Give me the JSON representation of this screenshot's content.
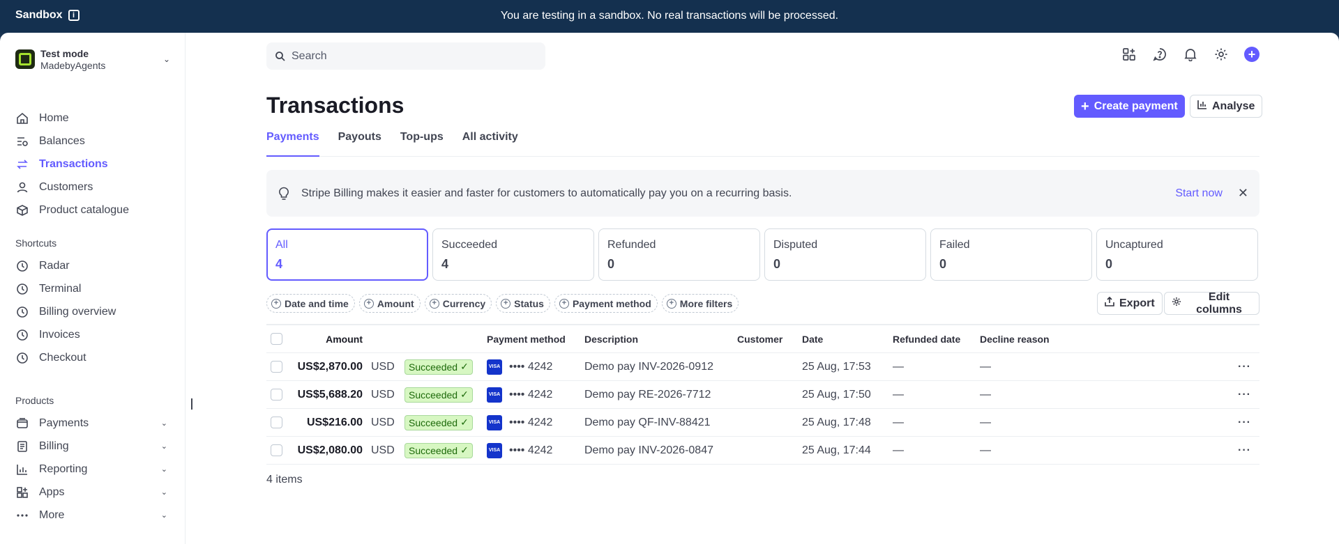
{
  "banner": {
    "label": "Sandbox",
    "message": "You are testing in a sandbox. No real transactions will be processed."
  },
  "account": {
    "mode": "Test mode",
    "name": "MadebyAgents"
  },
  "nav": {
    "main": [
      {
        "label": "Home",
        "icon": "home-icon"
      },
      {
        "label": "Balances",
        "icon": "balances-icon"
      },
      {
        "label": "Transactions",
        "icon": "transactions-icon",
        "active": true
      },
      {
        "label": "Customers",
        "icon": "customers-icon"
      },
      {
        "label": "Product catalogue",
        "icon": "product-icon"
      }
    ],
    "shortcuts_title": "Shortcuts",
    "shortcuts": [
      "Radar",
      "Terminal",
      "Billing overview",
      "Invoices",
      "Checkout"
    ],
    "products_title": "Products",
    "products": [
      "Payments",
      "Billing",
      "Reporting",
      "Apps",
      "More"
    ]
  },
  "search": {
    "placeholder": "Search"
  },
  "page": {
    "title": "Transactions",
    "create_label": "Create payment",
    "analyse_label": "Analyse"
  },
  "tabs": [
    "Payments",
    "Payouts",
    "Top-ups",
    "All activity"
  ],
  "notice": {
    "text": "Stripe Billing makes it easier and faster for customers to automatically pay you on a recurring basis.",
    "link": "Start now"
  },
  "cards": [
    {
      "label": "All",
      "count": "4"
    },
    {
      "label": "Succeeded",
      "count": "4"
    },
    {
      "label": "Refunded",
      "count": "0"
    },
    {
      "label": "Disputed",
      "count": "0"
    },
    {
      "label": "Failed",
      "count": "0"
    },
    {
      "label": "Uncaptured",
      "count": "0"
    }
  ],
  "filters": [
    "Date and time",
    "Amount",
    "Currency",
    "Status",
    "Payment method",
    "More filters"
  ],
  "actions": {
    "export": "Export",
    "edit_columns": "Edit columns"
  },
  "table": {
    "headers": {
      "amount": "Amount",
      "payment_method": "Payment method",
      "description": "Description",
      "customer": "Customer",
      "date": "Date",
      "refunded_date": "Refunded date",
      "decline_reason": "Decline reason"
    },
    "rows": [
      {
        "amount": "US$2,870.00",
        "currency": "USD",
        "status": "Succeeded",
        "card": "•••• 4242",
        "description": "Demo pay INV-2026-0912",
        "date": "25 Aug, 17:53",
        "refunded": "—",
        "decline": "—"
      },
      {
        "amount": "US$5,688.20",
        "currency": "USD",
        "status": "Succeeded",
        "card": "•••• 4242",
        "description": "Demo pay RE-2026-7712",
        "date": "25 Aug, 17:50",
        "refunded": "—",
        "decline": "—"
      },
      {
        "amount": "US$216.00",
        "currency": "USD",
        "status": "Succeeded",
        "card": "•••• 4242",
        "description": "Demo pay QF-INV-88421",
        "date": "25 Aug, 17:48",
        "refunded": "—",
        "decline": "—"
      },
      {
        "amount": "US$2,080.00",
        "currency": "USD",
        "status": "Succeeded",
        "card": "•••• 4242",
        "description": "Demo pay INV-2026-0847",
        "date": "25 Aug, 17:44",
        "refunded": "—",
        "decline": "—"
      }
    ],
    "visa_text": "VISA",
    "more_text": "···"
  },
  "footer": {
    "count": "4 items"
  },
  "colors": {
    "accent": "#635bff",
    "banner": "#14304f",
    "success_bg": "#d7f7c2",
    "success_text": "#1d6a0a"
  }
}
